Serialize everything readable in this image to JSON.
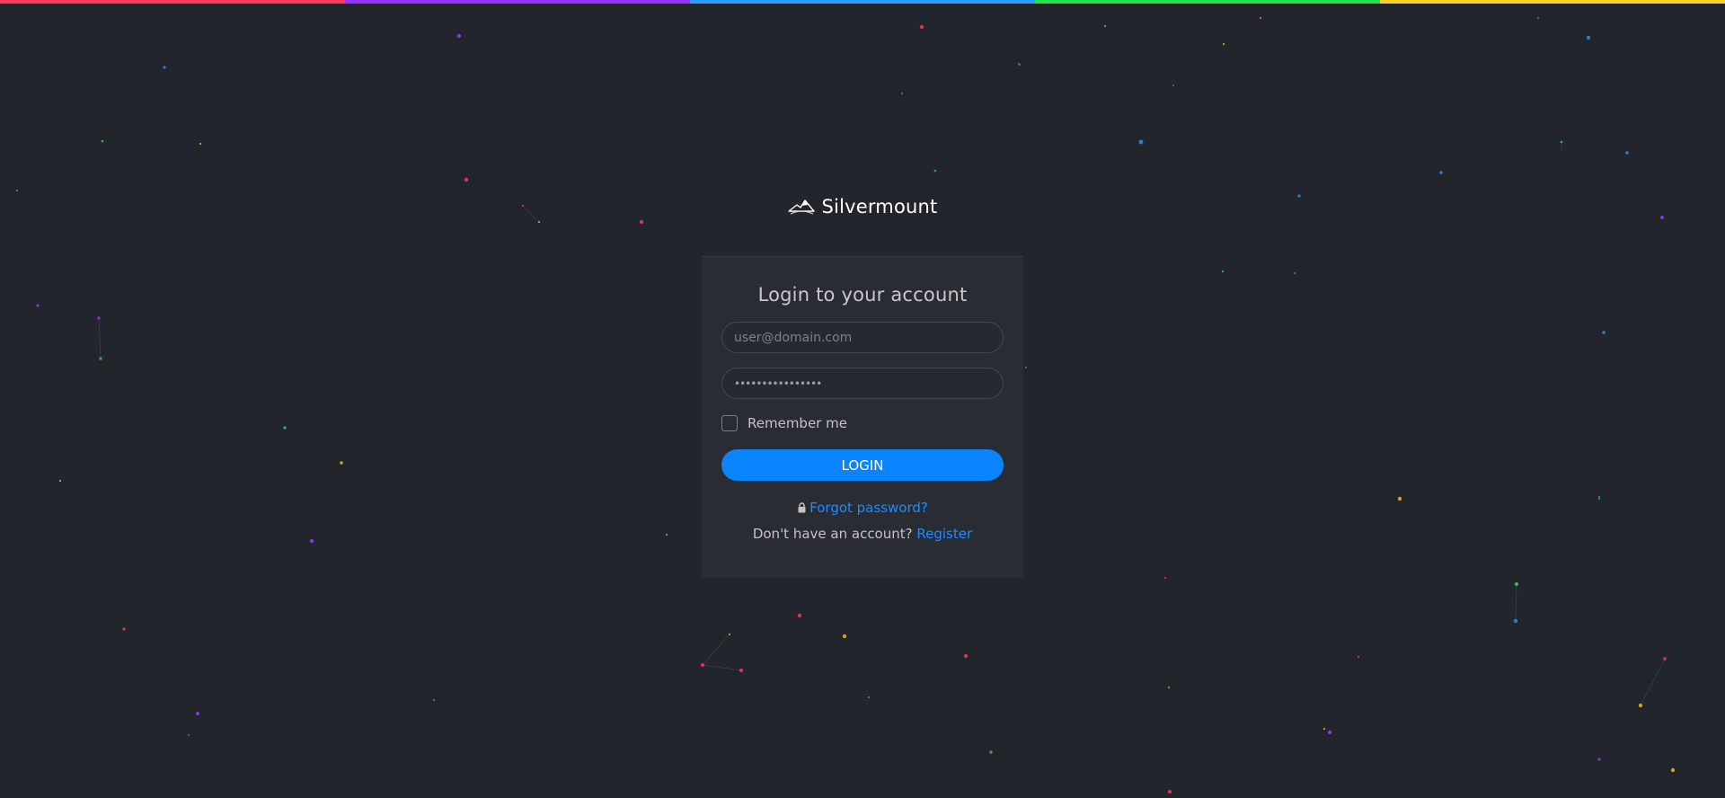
{
  "top_bar": {
    "colors": [
      "#ff3b5c",
      "#9b30ff",
      "#2d9cff",
      "#25e34a",
      "#ffd21f"
    ]
  },
  "brand": {
    "name": "Silvermount",
    "logo_icon": "mountain-icon"
  },
  "login_form": {
    "title": "Login to your account",
    "email_placeholder": "user@domain.com",
    "password_value": "••••••••••••••••",
    "remember_label": "Remember me",
    "remember_checked": false,
    "login_button": "LOGIN",
    "forgot_icon": "lock-icon",
    "forgot_link": "Forgot password?",
    "register_prompt": "Don't have an account?",
    "register_link": "Register"
  },
  "colors": {
    "background": "#22252b",
    "card": "#292c33",
    "accent": "#0a84ff",
    "link": "#1e8bff"
  }
}
